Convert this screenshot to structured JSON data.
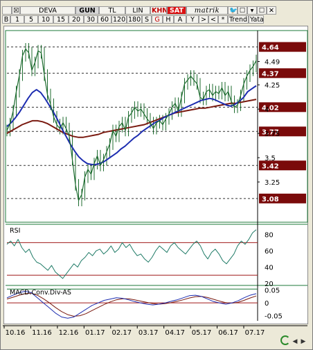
{
  "toolbar_top": [
    {
      "label": "",
      "name": "menu-button",
      "w": 14
    },
    {
      "label": "☒",
      "name": "close-chart-icon",
      "w": 12
    },
    {
      "label": "DEVA",
      "name": "symbol-field",
      "w": 80
    },
    {
      "label": "GUN",
      "name": "period-daily-button",
      "w": 34,
      "active": true
    },
    {
      "label": "TL",
      "name": "currency-tl-button",
      "w": 38
    },
    {
      "label": "LIN",
      "name": "scale-linear-button",
      "w": 36
    },
    {
      "label": "KHN",
      "name": "khn-button",
      "w": 24,
      "style": "khn"
    },
    {
      "label": "SAT",
      "name": "sell-button",
      "w": 28,
      "style": "sat"
    },
    {
      "label": "matrik",
      "name": "brand-logo",
      "w": 60,
      "style": "brand"
    },
    {
      "label": "🐦",
      "name": "twitter-icon",
      "w": 14
    },
    {
      "label": "☐",
      "name": "window-icon",
      "w": 14
    },
    {
      "label": "▾",
      "name": "dropdown-icon",
      "w": 14
    },
    {
      "label": "☐",
      "name": "maximize-icon",
      "w": 14
    },
    {
      "label": "✕",
      "name": "close-icon",
      "w": 14
    }
  ],
  "toolbar_bottom": [
    {
      "label": "B",
      "name": "interval-b-button",
      "w": 12
    },
    {
      "label": "1",
      "name": "interval-1-button",
      "w": 20
    },
    {
      "label": "5",
      "name": "interval-5-button",
      "w": 20
    },
    {
      "label": "10",
      "name": "interval-10-button",
      "w": 22
    },
    {
      "label": "15",
      "name": "interval-15-button",
      "w": 22
    },
    {
      "label": "20",
      "name": "interval-20-button",
      "w": 22
    },
    {
      "label": "30",
      "name": "interval-30-button",
      "w": 20
    },
    {
      "label": "60",
      "name": "interval-60-button",
      "w": 20
    },
    {
      "label": "120",
      "name": "interval-120-button",
      "w": 22
    },
    {
      "label": "180",
      "name": "interval-180-button",
      "w": 22
    },
    {
      "label": "S",
      "name": "interval-s-button",
      "w": 14
    },
    {
      "label": "G",
      "name": "interval-g-button",
      "w": 16,
      "style": "red"
    },
    {
      "label": "H",
      "name": "interval-h-button",
      "w": 16
    },
    {
      "label": "A",
      "name": "interval-a-button",
      "w": 18
    },
    {
      "label": "Y",
      "name": "interval-y-button",
      "w": 18
    },
    {
      "label": ">",
      "name": "scroll-right-button",
      "w": 14
    },
    {
      "label": "<",
      "name": "scroll-left-button",
      "w": 14
    },
    {
      "label": "*",
      "name": "favorite-button",
      "w": 14
    },
    {
      "label": "Trend",
      "name": "trend-button",
      "w": 30
    },
    {
      "label": "Yata",
      "name": "horizontal-button",
      "w": 22
    }
  ],
  "colors": {
    "price": "#1c6b2e",
    "ma_fast": "#1c2cb0",
    "ma_slow": "#7a1a10",
    "rsi": "#1e7a66",
    "macd": "#1c2cb0",
    "signal": "#7a1a10",
    "label_bg": "#7a0a0a",
    "level_line": "#333333",
    "rsi_band": "#a01818"
  },
  "chart_data": {
    "type": "line",
    "symbol": "DEVA",
    "x_tick_labels": [
      "10.16",
      "11.16",
      "12.16",
      "01.17",
      "02.17",
      "03.17",
      "04.17",
      "05.17",
      "06.17",
      "07.17"
    ],
    "price_axis": {
      "ylim": [
        2.85,
        4.78
      ],
      "tick_labels": [
        "4.49",
        "4.25",
        "4",
        "3.75",
        "3.5",
        "3.25"
      ],
      "tick_values": [
        4.49,
        4.25,
        4.0,
        3.75,
        3.5,
        3.25
      ]
    },
    "levels": [
      4.64,
      4.37,
      4.02,
      3.77,
      3.42,
      3.08
    ],
    "level_labels": [
      "4.64",
      "4.37",
      "4.02",
      "3.77",
      "3.42",
      "3.08"
    ],
    "price_series": [
      3.78,
      3.85,
      3.98,
      4.18,
      4.35,
      4.55,
      4.62,
      4.58,
      4.4,
      4.48,
      4.6,
      4.58,
      4.35,
      4.15,
      4.05,
      3.92,
      3.84,
      3.8,
      3.86,
      3.8,
      3.72,
      3.48,
      3.22,
      3.06,
      3.12,
      3.3,
      3.38,
      3.33,
      3.44,
      3.52,
      3.42,
      3.48,
      3.56,
      3.64,
      3.78,
      3.72,
      3.82,
      3.86,
      3.78,
      3.92,
      3.96,
      4.02,
      3.98,
      4.0,
      3.95,
      3.9,
      3.86,
      3.8,
      3.86,
      3.88,
      3.84,
      3.9,
      3.95,
      4.02,
      4.06,
      3.98,
      4.12,
      4.26,
      4.3,
      4.34,
      4.3,
      4.26,
      4.12,
      4.1,
      4.18,
      4.2,
      4.14,
      4.18,
      4.16,
      4.22,
      4.14,
      4.18,
      4.08,
      4.02,
      4.04,
      4.14,
      4.26,
      4.34,
      4.4,
      4.44,
      4.5
    ],
    "ma_fast_series": [
      3.82,
      3.86,
      3.91,
      3.97,
      4.04,
      4.11,
      4.17,
      4.2,
      4.17,
      4.11,
      4.04,
      3.97,
      3.89,
      3.8,
      3.72,
      3.64,
      3.57,
      3.51,
      3.47,
      3.44,
      3.43,
      3.43,
      3.44,
      3.46,
      3.49,
      3.52,
      3.55,
      3.59,
      3.62,
      3.66,
      3.7,
      3.73,
      3.77,
      3.8,
      3.83,
      3.86,
      3.88,
      3.91,
      3.93,
      3.95,
      3.97,
      3.99,
      4.01,
      4.03,
      4.05,
      4.07,
      4.09,
      4.1,
      4.11,
      4.1,
      4.08,
      4.06,
      4.04,
      4.03,
      4.05,
      4.08,
      4.12,
      4.18,
      4.21,
      4.24
    ],
    "ma_slow_series": [
      3.75,
      3.78,
      3.81,
      3.84,
      3.86,
      3.88,
      3.88,
      3.87,
      3.85,
      3.82,
      3.79,
      3.76,
      3.74,
      3.72,
      3.71,
      3.71,
      3.72,
      3.73,
      3.74,
      3.76,
      3.77,
      3.78,
      3.79,
      3.8,
      3.81,
      3.82,
      3.83,
      3.84,
      3.86,
      3.88,
      3.9,
      3.92,
      3.94,
      3.96,
      3.97,
      3.98,
      3.99,
      4.0,
      4.01,
      4.01,
      4.02,
      4.03,
      4.04,
      4.05,
      4.06,
      4.06,
      4.07,
      4.08,
      4.09,
      4.1
    ],
    "rsi": {
      "label": "RSI",
      "ylim": [
        20,
        90
      ],
      "tick_labels": [
        "80",
        "60",
        "40",
        "20"
      ],
      "tick_values": [
        80,
        60,
        40,
        20
      ],
      "bands": [
        70,
        30
      ],
      "values": [
        68,
        72,
        66,
        74,
        64,
        58,
        62,
        52,
        46,
        44,
        40,
        36,
        42,
        34,
        30,
        26,
        32,
        38,
        44,
        40,
        48,
        52,
        58,
        54,
        60,
        62,
        56,
        60,
        66,
        58,
        62,
        70,
        64,
        68,
        60,
        54,
        56,
        50,
        46,
        52,
        60,
        66,
        62,
        58,
        66,
        70,
        64,
        60,
        56,
        62,
        68,
        72,
        66,
        56,
        50,
        58,
        62,
        56,
        48,
        44,
        50,
        56,
        66,
        72,
        68,
        74,
        82,
        86
      ]
    },
    "macd": {
      "label": "MACD.Conv.Div-AS",
      "ylim": [
        -0.07,
        0.06
      ],
      "tick_labels": [
        "0.05",
        "0",
        "-0.05"
      ],
      "tick_values": [
        0.05,
        0.0,
        -0.05
      ],
      "macd_values": [
        0.02,
        0.03,
        0.04,
        0.045,
        0.04,
        0.02,
        0.0,
        -0.02,
        -0.04,
        -0.055,
        -0.06,
        -0.055,
        -0.04,
        -0.025,
        -0.01,
        0.0,
        0.01,
        0.015,
        0.02,
        0.018,
        0.012,
        0.005,
        0.0,
        -0.005,
        -0.008,
        -0.005,
        0.0,
        0.006,
        0.012,
        0.02,
        0.028,
        0.03,
        0.025,
        0.015,
        0.005,
        0.0,
        -0.005,
        0.0,
        0.008,
        0.02,
        0.03,
        0.036
      ],
      "signal_values": [
        0.015,
        0.022,
        0.03,
        0.036,
        0.038,
        0.03,
        0.016,
        0.0,
        -0.018,
        -0.034,
        -0.046,
        -0.052,
        -0.05,
        -0.042,
        -0.03,
        -0.018,
        -0.006,
        0.004,
        0.012,
        0.016,
        0.016,
        0.012,
        0.007,
        0.002,
        -0.003,
        -0.005,
        -0.003,
        0.001,
        0.006,
        0.012,
        0.019,
        0.024,
        0.025,
        0.021,
        0.014,
        0.007,
        0.001,
        -0.001,
        0.002,
        0.01,
        0.019,
        0.027
      ]
    }
  }
}
